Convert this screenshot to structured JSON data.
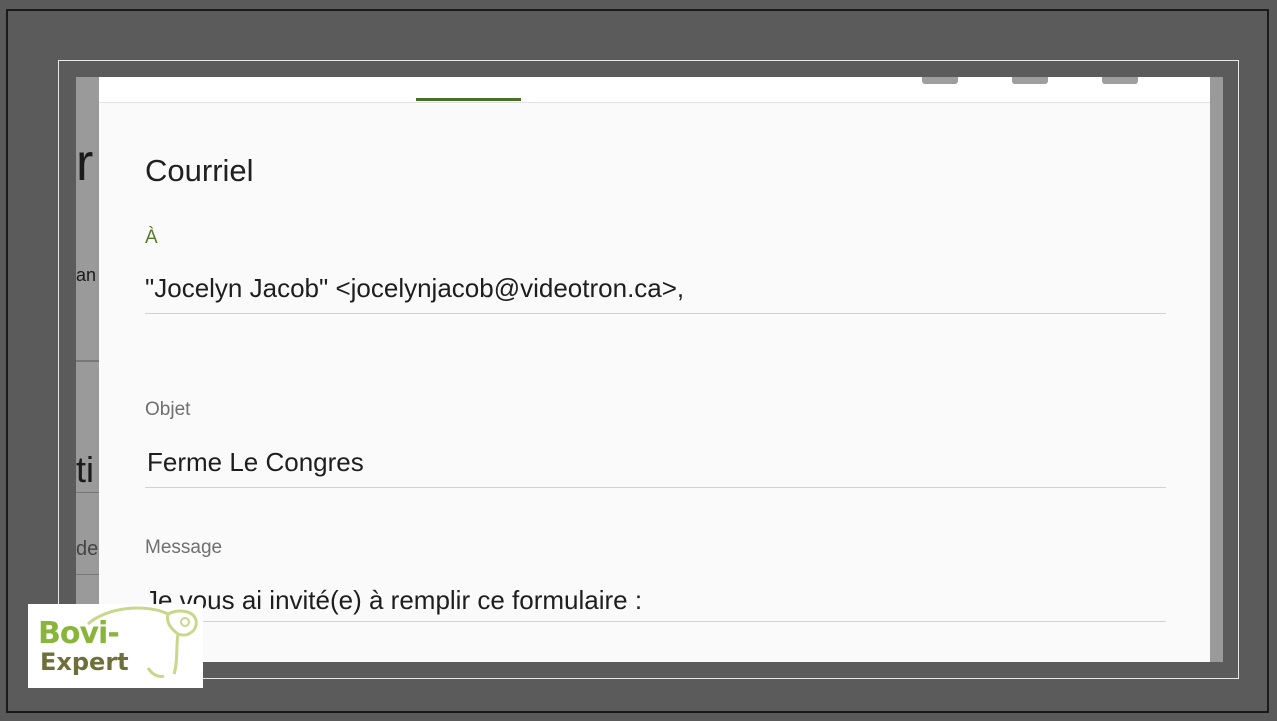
{
  "background_fragments": {
    "frag1": "r",
    "frag2": "an",
    "frag3": "ti",
    "frag4": "de"
  },
  "dialog": {
    "title": "Courriel",
    "to_label": "À",
    "to_value": "\"Jocelyn Jacob\" <jocelynjacob@videotron.ca>,",
    "subject_label": "Objet",
    "subject_value": "Ferme  Le Congres",
    "message_label": "Message",
    "message_value": "Je vous ai invité(e) à remplir ce formulaire :"
  },
  "logo": {
    "line1": "Bovi-",
    "line2": "Expert"
  },
  "colors": {
    "accent_green": "#4a6f2a",
    "frame_gray": "#5a5a5a",
    "logo_green": "#89b53a"
  }
}
